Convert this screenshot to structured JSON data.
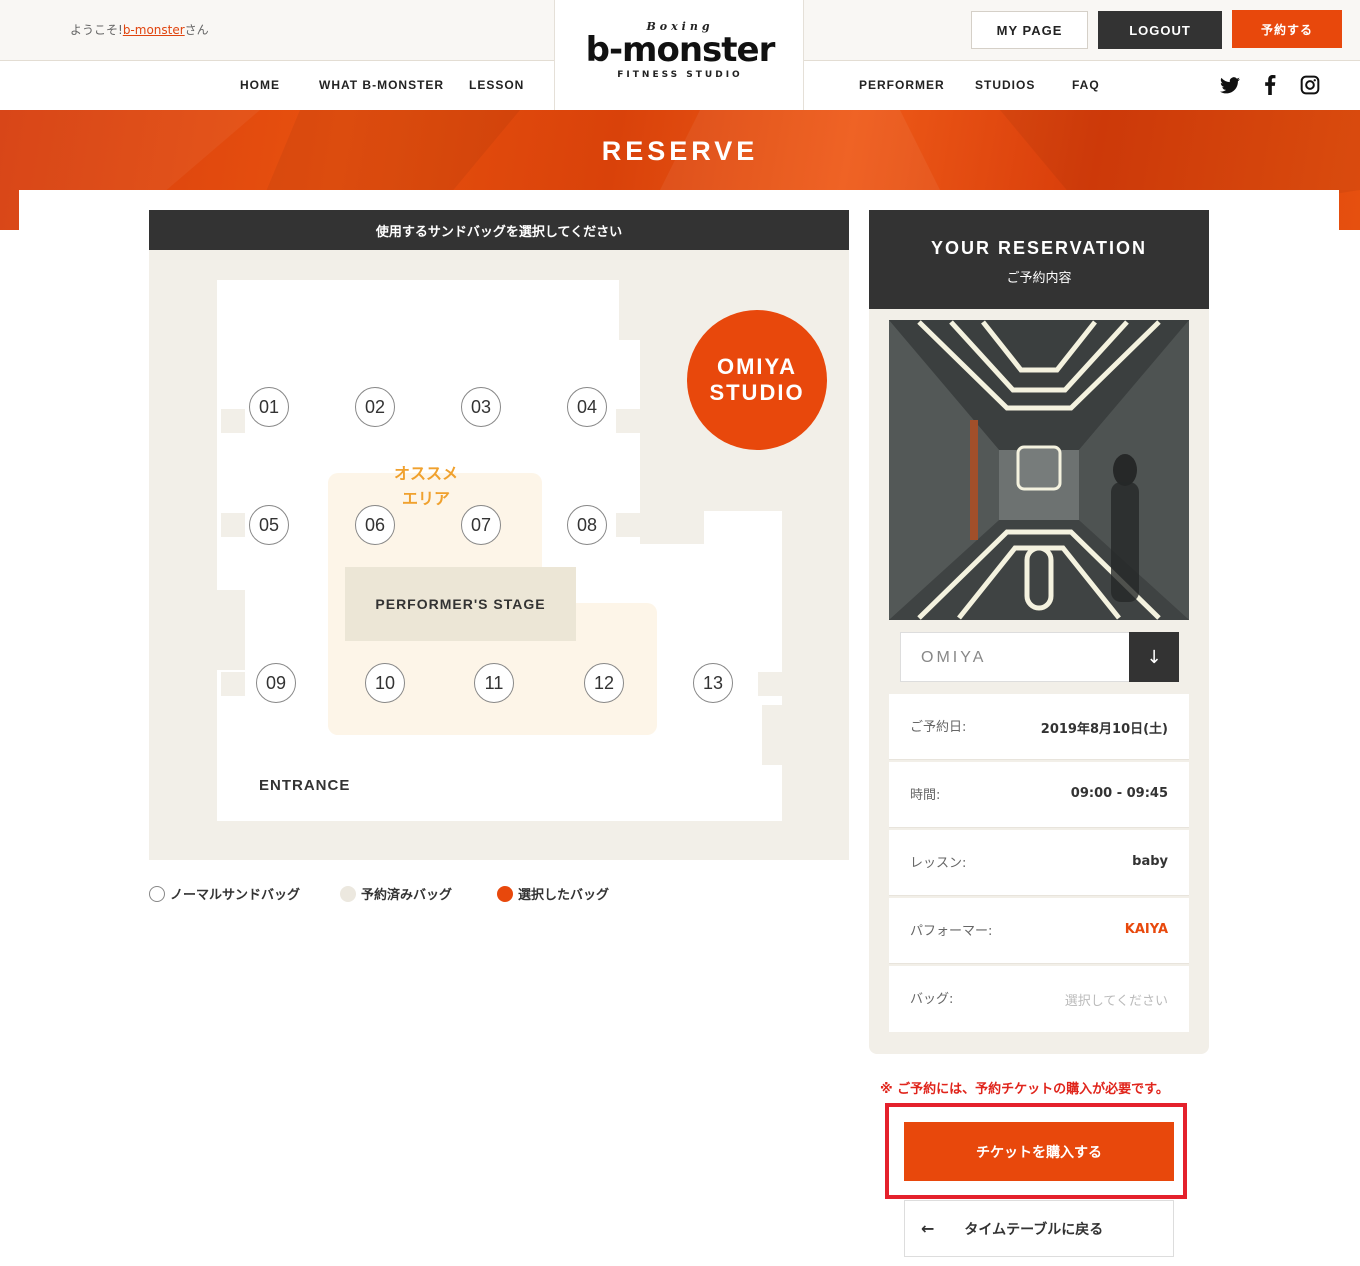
{
  "header": {
    "welcome_prefix": "ようこそ!",
    "welcome_user": "b-monster",
    "welcome_suffix": "さん",
    "logo_top": "Boxing",
    "logo_main": "b-monster",
    "logo_sub": "FITNESS STUDIO",
    "nav_left": [
      "HOME",
      "WHAT B-MONSTER",
      "LESSON"
    ],
    "nav_right": [
      "PERFORMER",
      "STUDIOS",
      "FAQ"
    ],
    "mypage": "MY PAGE",
    "logout": "LOGOUT",
    "reserve": "予約する",
    "social_icons": [
      "twitter-icon",
      "facebook-icon",
      "instagram-icon"
    ]
  },
  "banner": {
    "title": "RESERVE"
  },
  "map": {
    "header": "使用するサンドバッグを選択してください",
    "studio_line1": "OMIYA",
    "studio_line2": "STUDIO",
    "recommend_line1": "オススメ",
    "recommend_line2": "エリア",
    "stage": "PERFORMER'S STAGE",
    "entrance": "ENTRANCE",
    "bags": [
      "01",
      "02",
      "03",
      "04",
      "05",
      "06",
      "07",
      "08",
      "09",
      "10",
      "11",
      "12",
      "13"
    ]
  },
  "legend": {
    "normal": "ノーマルサンドバッグ",
    "reserved": "予約済みバッグ",
    "selected": "選択したバッグ"
  },
  "reservation": {
    "title": "YOUR RESERVATION",
    "subtitle": "ご予約内容",
    "studio": "OMIYA",
    "rows": [
      {
        "label": "ご予約日:",
        "value": "2019年8月10日(土)"
      },
      {
        "label": "時間:",
        "value": "09:00 - 09:45"
      },
      {
        "label": "レッスン:",
        "value": "baby"
      },
      {
        "label": "パフォーマー:",
        "value": "KAIYA"
      },
      {
        "label": "バッグ:",
        "value": "選択してください"
      }
    ]
  },
  "note": "※ ご予約には、予約チケットの購入が必要です。",
  "buy_button": "チケットを購入する",
  "back_button": "タイムテーブルに戻る",
  "colors": {
    "accent": "#e8480c",
    "dark": "#333333",
    "highlight": "#e4212c",
    "recommend": "#f0a12e"
  }
}
